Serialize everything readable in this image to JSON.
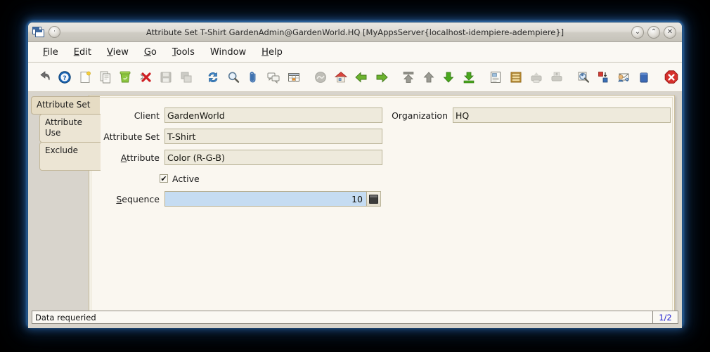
{
  "window": {
    "title": "Attribute Set  T-Shirt  GardenAdmin@GardenWorld.HQ [MyAppsServer{localhost-idempiere-adempiere}]",
    "minimize_label": "⌄",
    "maximize_label": "⌃",
    "close_label": "✕",
    "system_menu_label": "·"
  },
  "menubar": {
    "items": [
      {
        "mnemonic": "F",
        "rest": "ile"
      },
      {
        "mnemonic": "E",
        "rest": "dit"
      },
      {
        "mnemonic": "V",
        "rest": "iew"
      },
      {
        "mnemonic": "G",
        "rest": "o"
      },
      {
        "mnemonic": "T",
        "rest": "ools"
      },
      {
        "mnemonic": "",
        "rest": "Window"
      },
      {
        "mnemonic": "H",
        "rest": "elp"
      }
    ]
  },
  "toolbar": {
    "buttons": [
      "undo-icon",
      "help-icon",
      "new-record-icon",
      "copy-record-icon",
      "recycle-bin-icon",
      "delete-record-icon",
      "save-icon",
      "save-copy-icon",
      "refresh-icon",
      "find-icon",
      "attachment-icon",
      "chat-icon",
      "grid-toggle-icon",
      "history-icon",
      "home-icon",
      "back-icon",
      "forward-icon",
      "first-record-icon",
      "previous-record-icon",
      "next-record-icon",
      "last-record-icon",
      "report-icon",
      "archive-icon",
      "print-preview-icon",
      "print-icon",
      "zoom-across-icon",
      "process-icon",
      "request-icon",
      "product-info-icon",
      "exit-icon"
    ]
  },
  "tabs": {
    "items": [
      {
        "label": "Attribute Set",
        "selected": true
      },
      {
        "label": "Attribute Use",
        "selected": false
      },
      {
        "label": "Exclude",
        "selected": false
      }
    ]
  },
  "form": {
    "client": {
      "label": "Client",
      "value": "GardenWorld"
    },
    "organization": {
      "label": "Organization",
      "value": "HQ"
    },
    "attribute_set": {
      "label": "Attribute Set",
      "value": "T-Shirt"
    },
    "attribute": {
      "label": "Attribute",
      "label_mnemonic": "A",
      "label_rest": "ttribute",
      "value": "Color (R-G-B)"
    },
    "active": {
      "label": "Active",
      "checked": true,
      "check_glyph": "✔"
    },
    "sequence": {
      "label": "Sequence",
      "label_mnemonic": "S",
      "label_rest": "equence",
      "value": "10"
    }
  },
  "statusbar": {
    "message": "Data requeried",
    "record_count": "1/2"
  },
  "colors": {
    "window_chrome": "#d8d4cc",
    "panel_bg": "#faf7f0",
    "field_bg": "#eeeadc",
    "field_focus_bg": "#c5dcf2",
    "tab_bg": "#ece5d4",
    "accent_blue": "#1a1ad0",
    "glow": "#2d6eb4"
  }
}
